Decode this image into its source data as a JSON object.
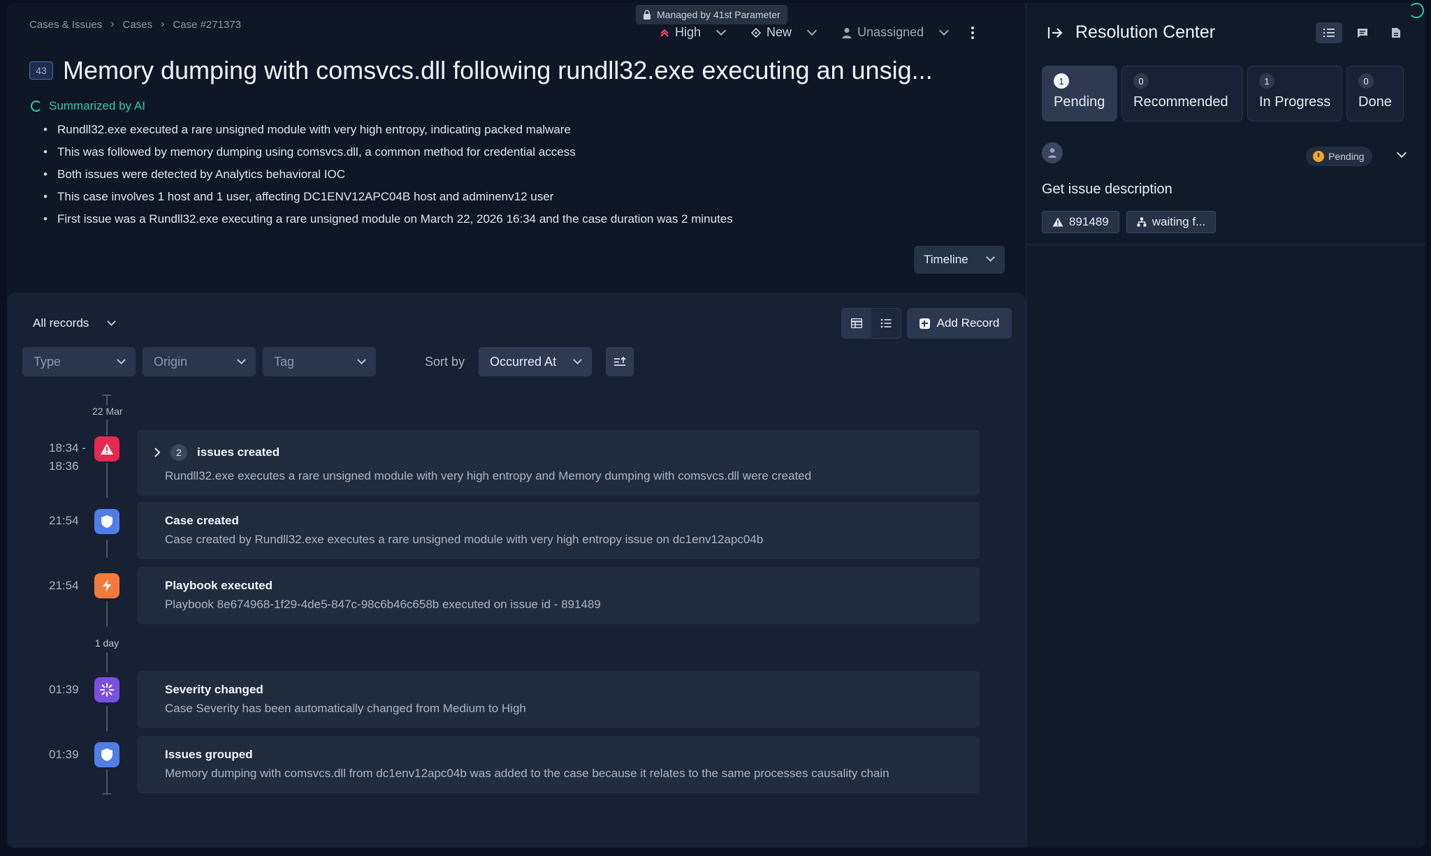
{
  "breadcrumb": [
    "Cases & Issues",
    "Cases",
    "Case #271373"
  ],
  "managed_label": "Managed by 41st Parameter",
  "severity": "High",
  "status": "New",
  "assignee": "Unassigned",
  "case_badge": "43",
  "title": "Memory dumping with comsvcs.dll following rundll32.exe executing an unsig...",
  "ai_label": "Summarized by AI",
  "summary": [
    "Rundll32.exe executed a rare unsigned module with very high entropy, indicating packed malware",
    "This was followed by memory dumping using comsvcs.dll, a common method for credential access",
    "Both issues were detected by Analytics behavioral IOC",
    "This case involves 1 host and 1 user, affecting DC1ENV12APC04B host and adminenv12 user",
    "First issue was a Rundll32.exe executing a rare unsigned module on March 22, 2026 16:34 and the case duration was 2 minutes"
  ],
  "timeline_button": "Timeline",
  "records": {
    "all_records": "All records",
    "add_record": "Add Record",
    "filters": {
      "type": "Type",
      "origin": "Origin",
      "tag": "Tag"
    },
    "sort_by_label": "Sort by",
    "sort_value": "Occurred At"
  },
  "timeline": {
    "date_label": "22 Mar",
    "gap_label": "1 day",
    "events": [
      {
        "time": "18:34 -",
        "time2": "18:36",
        "count": "2",
        "title": "issues created",
        "desc": "Rundll32.exe executes a rare unsigned module with very high entropy and Memory dumping with comsvcs.dll were created",
        "color": "#e5294f",
        "icon": "alert-triangle-icon"
      },
      {
        "time": "21:54",
        "title": "Case created",
        "desc": "Case created by Rundll32.exe executes a rare unsigned module with very high entropy issue on dc1env12apc04b",
        "color": "#4f7fe6",
        "icon": "shield-icon"
      },
      {
        "time": "21:54",
        "title": "Playbook executed",
        "desc": "Playbook 8e674968-1f29-4de5-847c-98c6b46c658b executed on issue id - 891489",
        "color": "#f27a3a",
        "icon": "bolt-icon"
      },
      {
        "time": "01:39",
        "title": "Severity changed",
        "desc": "Case Severity has been automatically changed from Medium to High",
        "color": "#7b4fe0",
        "icon": "sparkle-icon"
      },
      {
        "time": "01:39",
        "title": "Issues grouped",
        "desc": "Memory dumping with comsvcs.dll from dc1env12apc04b was added to the case because it relates to the same processes causality chain",
        "color": "#4f7fe6",
        "icon": "shield-icon"
      }
    ]
  },
  "resolution_center": {
    "title": "Resolution Center",
    "tabs": [
      {
        "count": "1",
        "label": "Pending"
      },
      {
        "count": "0",
        "label": "Recommended"
      },
      {
        "count": "1",
        "label": "In Progress"
      },
      {
        "count": "0",
        "label": "Done"
      }
    ],
    "task_status": "Pending",
    "task_title": "Get issue description",
    "chips": [
      "891489",
      "waiting f..."
    ]
  }
}
